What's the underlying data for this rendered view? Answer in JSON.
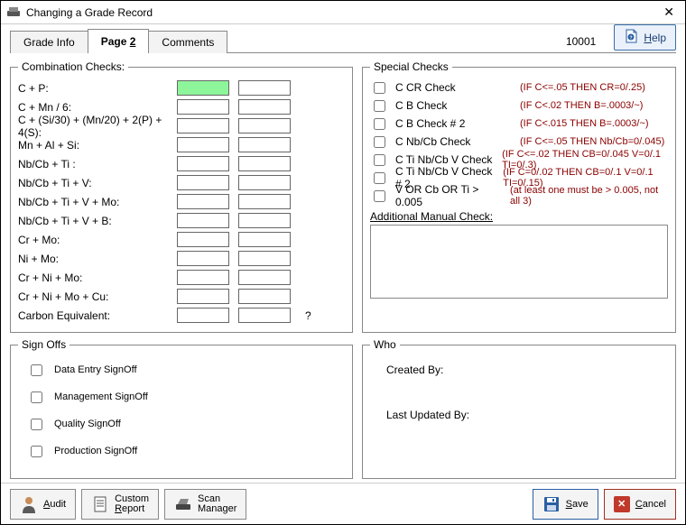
{
  "window": {
    "title": "Changing a Grade Record",
    "record_id": "10001"
  },
  "tabs": {
    "grade_info": "Grade Info",
    "page2": "Page 2",
    "comments": "Comments"
  },
  "help": {
    "label": "Help"
  },
  "combination": {
    "legend": "Combination Checks:",
    "rows": [
      "C + P:",
      "C + Mn / 6:",
      "C + (Si/30) + (Mn/20) + 2(P) + 4(S):",
      "Mn + Al + Si:",
      "Nb/Cb + Ti :",
      "Nb/Cb + Ti + V:",
      "Nb/Cb + Ti + V + Mo:",
      "Nb/Cb + Ti  + V + B:",
      "Cr + Mo:",
      "Ni + Mo:",
      "Cr + Ni + Mo:",
      "Cr + Ni + Mo + Cu:",
      "Carbon Equivalent:"
    ],
    "qmark": "?"
  },
  "special": {
    "legend": "Special Checks",
    "rows": [
      {
        "label": "C CR Check",
        "cond": "(IF C<=.05 THEN CR=0/.25)"
      },
      {
        "label": "C B Check",
        "cond": "(IF C<.02 THEN B=.0003/~)"
      },
      {
        "label": "C B Check # 2",
        "cond": "(IF C<.015 THEN B=.0003/~)"
      },
      {
        "label": "C Nb/Cb Check",
        "cond": "(IF C<=.05 THEN Nb/Cb=0/.045)"
      },
      {
        "label": "C Ti Nb/Cb V Check",
        "cond": "(IF C<=.02 THEN CB=0/.045 V=0/.1 TI=0/.3)"
      },
      {
        "label": "C Ti Nb/Cb V Check # 2",
        "cond": "(IF C=0/.02 THEN CB=0/.1 V=0/.1 TI=0/.15)"
      },
      {
        "label": "V OR Cb OR Ti > 0.005",
        "cond": "(at least one must be > 0.005, not all 3)"
      }
    ],
    "amc_label": "Additional Manual Check:",
    "amc_value": ""
  },
  "signoffs": {
    "legend": "Sign Offs",
    "items": [
      "Data Entry SignOff",
      "Management  SignOff",
      "Quality SignOff",
      "Production SignOff"
    ]
  },
  "who": {
    "legend": "Who",
    "created": "Created By:",
    "updated": "Last Updated By:"
  },
  "footer": {
    "audit": "Audit",
    "custom_report_l1": "Custom",
    "custom_report_l2": "Report",
    "scan_l1": "Scan",
    "scan_l2": "Manager",
    "save": "Save",
    "cancel": "Cancel"
  }
}
